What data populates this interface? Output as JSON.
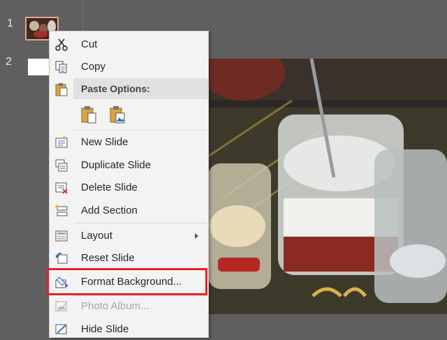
{
  "slides": [
    {
      "number": "1"
    },
    {
      "number": "2"
    }
  ],
  "context_menu": {
    "items": [
      {
        "label": "Cut",
        "icon": "scissors-icon"
      },
      {
        "label": "Copy",
        "icon": "copy-icon"
      },
      {
        "label": "Paste Options:",
        "icon": "clipboard-icon"
      },
      {
        "label": "New Slide",
        "icon": "new-slide-icon"
      },
      {
        "label": "Duplicate Slide",
        "icon": "duplicate-slide-icon"
      },
      {
        "label": "Delete Slide",
        "icon": "delete-slide-icon"
      },
      {
        "label": "Add Section",
        "icon": "add-section-icon"
      },
      {
        "label": "Layout",
        "icon": "layout-icon"
      },
      {
        "label": "Reset Slide",
        "icon": "reset-slide-icon"
      },
      {
        "label": "Format Background...",
        "icon": "format-background-icon"
      },
      {
        "label": "Photo Album...",
        "icon": "photo-album-icon",
        "disabled": true
      },
      {
        "label": "Hide Slide",
        "icon": "hide-slide-icon"
      }
    ],
    "paste_icons": [
      "paste-keep-formatting-icon",
      "paste-picture-icon"
    ]
  },
  "colors": {
    "highlight": "#e5202b",
    "menu_bg": "#f3f3f3",
    "workspace_bg": "#5f5f5f"
  }
}
